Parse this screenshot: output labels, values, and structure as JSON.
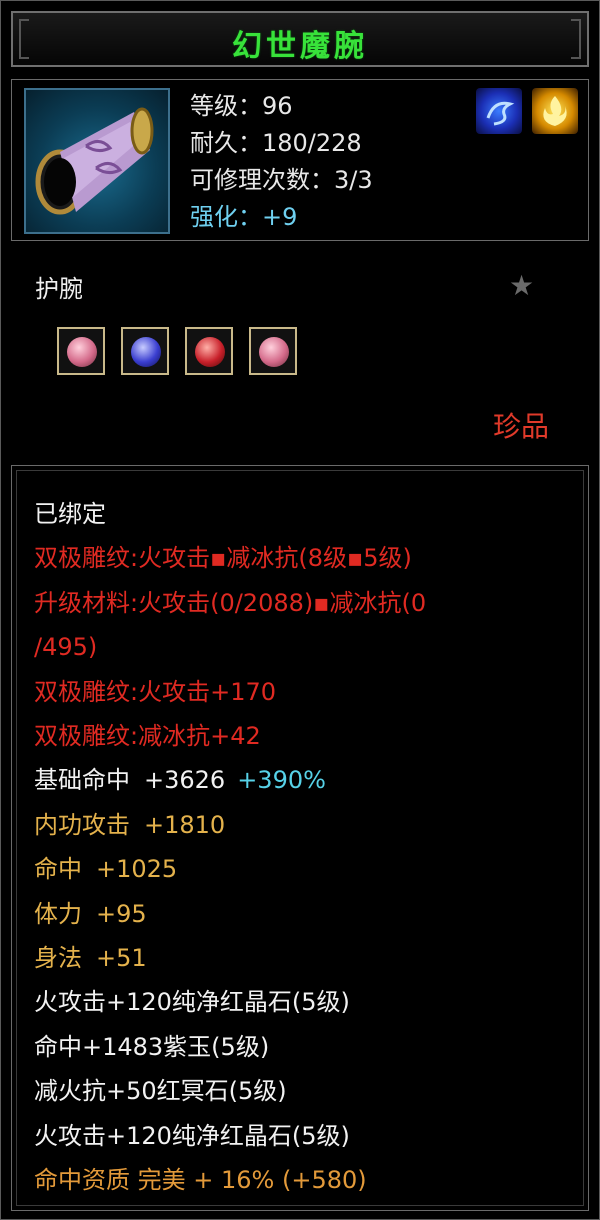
{
  "item": {
    "name": "幻世魔腕",
    "stats": {
      "level": "等级：96",
      "durability": "耐久：180/228",
      "repairs": "可修理次数：3/3",
      "enhance": "强化：+9"
    },
    "type": "护腕",
    "rarity": "珍品",
    "gems": [
      {
        "name": "pink-gem-icon",
        "color": "#d46a8a"
      },
      {
        "name": "blue-gem-icon",
        "color": "#3a3ed0"
      },
      {
        "name": "red-gem-icon",
        "color": "#c8202a"
      },
      {
        "name": "pink-gem-icon",
        "color": "#d46a8a"
      }
    ],
    "badges": [
      "blue-swirl-icon",
      "gold-flame-icon"
    ]
  },
  "attributes": {
    "bound": "已绑定",
    "carve1": "双极雕纹:火攻击▪减冰抗(8级▪5级)",
    "material_a": "升级材料:火攻击(0/2088)▪减冰抗(0",
    "material_b": "/495)",
    "carve2": "双极雕纹:火攻击+170",
    "carve3": "双极雕纹:减冰抗+42",
    "base_hit_label": "基础命中",
    "base_hit_value": "+3626",
    "base_hit_bonus": "+390%",
    "inner_attack_label": "内功攻击",
    "inner_attack_value": "+1810",
    "hit_label": "命中",
    "hit_value": "+1025",
    "stamina_label": "体力",
    "stamina_value": "+95",
    "agility_label": "身法",
    "agility_value": "+51",
    "gem1": "火攻击+120纯净红晶石(5级)",
    "gem2": "命中+1483紫玉(5级)",
    "gem3": "减火抗+50红冥石(5级)",
    "gem4": "火攻击+120纯净红晶石(5级)",
    "aptitude": "命中资质 完美 + 16% (+580)"
  },
  "colors": {
    "title": "#38e23a",
    "red": "#e02a22",
    "gold": "#e4b24c",
    "cyan": "#57d2e8"
  }
}
